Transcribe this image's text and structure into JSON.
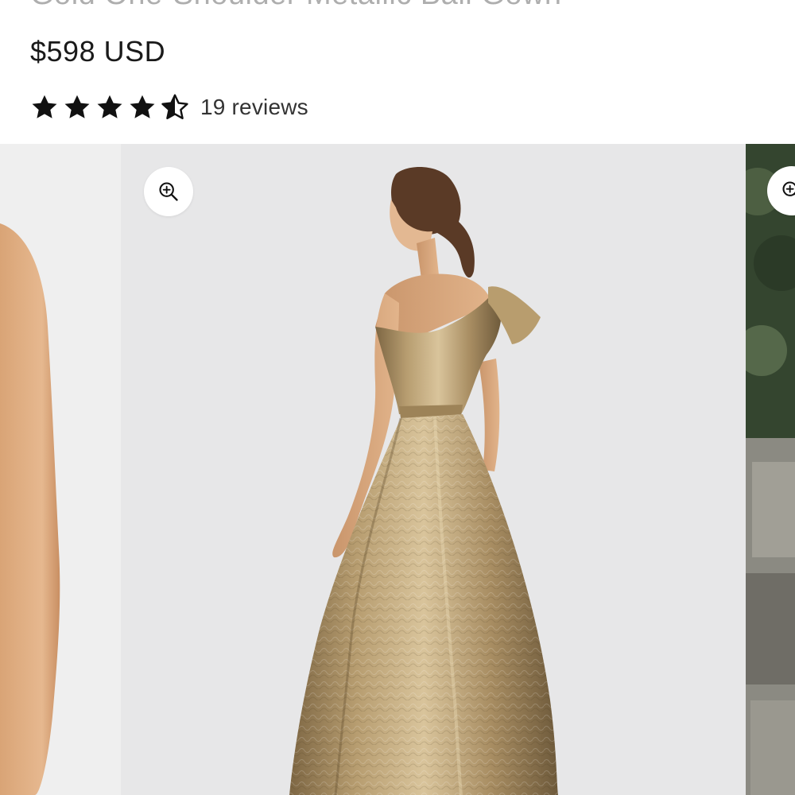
{
  "product": {
    "title": "Gold One-Shoulder Metallic Ball Gown",
    "price": "$598 USD",
    "rating": {
      "value": 4.5,
      "max": 5,
      "reviews_label": "19 reviews"
    }
  },
  "gallery": {
    "slides": [
      {
        "name": "partial-left-slide"
      },
      {
        "name": "main-slide",
        "zoom_icon": "zoom-in-icon"
      },
      {
        "name": "partial-right-slide",
        "zoom_icon": "zoom-in-icon"
      }
    ]
  },
  "colors": {
    "text": "#1a1a1a",
    "star": "#111111",
    "gallery_bg": "#e7e7e8",
    "gown": "#a88d62"
  }
}
